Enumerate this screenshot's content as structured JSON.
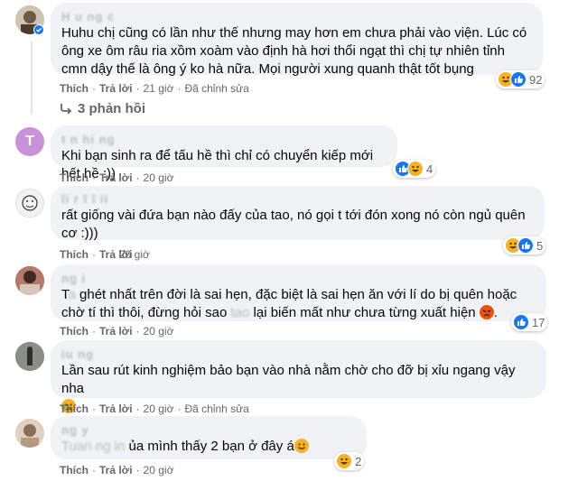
{
  "comments": [
    {
      "author": "H u ng  c",
      "text": "Huhu chị cũng có lần như thế nhưng may hơn em chưa phải vào viện. Lúc có ông xe ôm râu ria xồm xoàm vào định hà hơi thổi ngạt thì chị tự nhiên tỉnh cmn dậy thế là ông ý ko hà nữa. Mọi người xung quanh thật tốt bụng",
      "like": "Thích",
      "reply": "Trả lời",
      "time": "21 giờ",
      "edited": "Đã chỉnh sửa",
      "react_count": "92"
    },
    {
      "author": "t  n  hi   ng",
      "text": "Khi bạn sinh ra để tấu hề thì chỉ có chuyển kiếp mới hết hề :))",
      "like": "Thích",
      "reply": "Trả lời",
      "time": "20 giờ",
      "react_count": "4"
    },
    {
      "author": "ĩi  r  ĩ  ĩ ii",
      "text": "rất giống vài đứa bạn nào đấy của tao, nó gọi t tới đón xong nó còn ngủ quên cơ :)))",
      "like": "Thích",
      "reply": "Trả lời",
      "time": "20 giờ",
      "react_count": "5"
    },
    {
      "author": "ng  i",
      "text_prefix": "T",
      "text_a": " ghét nhất trên đời là sai hẹn, đặc biệt là sai hẹn ăn với lí do bị quên hoặc chờ tí thì thôi, đừng hỏi sao ",
      "text_b": " lại biến mất như chưa từng xuất hiện ",
      "text_suffix": ".",
      "like": "Thích",
      "reply": "Trả lời",
      "time": "20 giờ",
      "react_count": "17"
    },
    {
      "author": "iu  ng",
      "text": "Lần sau rút kinh nghiệm bảo bạn vào nhà nằm chờ cho đỡ bị xỉu ngang vậy nha",
      "like": "Thích",
      "reply": "Trả lời",
      "time": "20 giờ",
      "edited": "Đã chỉnh sửa"
    },
    {
      "author": "ng  y  ",
      "text": " ủa mình thấy 2 bạn ở đây á",
      "like": "Thích",
      "reply": "Trả lời",
      "time": "8 giờ",
      "react_count": "2"
    },
    {
      "like": "Thích",
      "reply": "Trả lời",
      "time": "20 giờ"
    }
  ],
  "replies_link": "3 phản hồi",
  "avatar_letter": "T",
  "colors": {
    "bubble": "#f0f2f5",
    "meta": "#65676b",
    "like": "#1877f2",
    "haha": "#f7b125",
    "angry": "#e9710f",
    "avatarT": "#c792d8"
  }
}
